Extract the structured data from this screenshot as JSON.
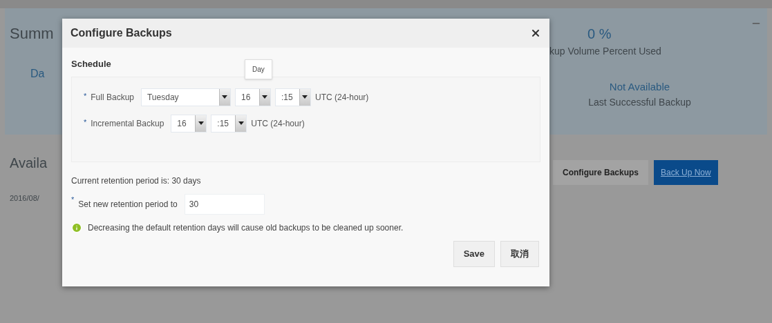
{
  "background": {
    "summary_title": "Summ",
    "summary_item": "Da",
    "volume_value": "0 %",
    "volume_label": "kup Volume Percent Used",
    "last_backup_value": "Not Available",
    "last_backup_label": "Last Successful Backup",
    "available_title": "Availa",
    "row_date": "2016/08/",
    "buttons": [
      {
        "label": "Configure Backups",
        "kind": "secondary"
      },
      {
        "label": "Back Up Now",
        "kind": "primary"
      }
    ]
  },
  "dialog": {
    "title": "Configure Backups",
    "schedule": {
      "title": "Schedule",
      "tooltip": "Day",
      "rows": [
        {
          "mark": "*",
          "label": "Full Backup",
          "selects": [
            {
              "value": "Tuesday",
              "kind": "wide"
            },
            {
              "value": "16",
              "kind": "narrow"
            },
            {
              "value": ":15",
              "kind": "narrow"
            }
          ],
          "zone": "UTC (24-hour)"
        },
        {
          "mark": "*",
          "label": "Incremental Backup",
          "selects": [
            {
              "value": "16",
              "kind": "narrow"
            },
            {
              "value": ":15",
              "kind": "narrow"
            }
          ],
          "zone": "UTC (24-hour)"
        }
      ]
    },
    "retention_text": "Current retention period is: 30 days",
    "retention_field": {
      "mark": "*",
      "label": "Set new retention period to",
      "value": "30"
    },
    "info": "Decreasing the default retention days will cause old backups to be cleaned up sooner.",
    "buttons": [
      "Save",
      "取消"
    ]
  }
}
